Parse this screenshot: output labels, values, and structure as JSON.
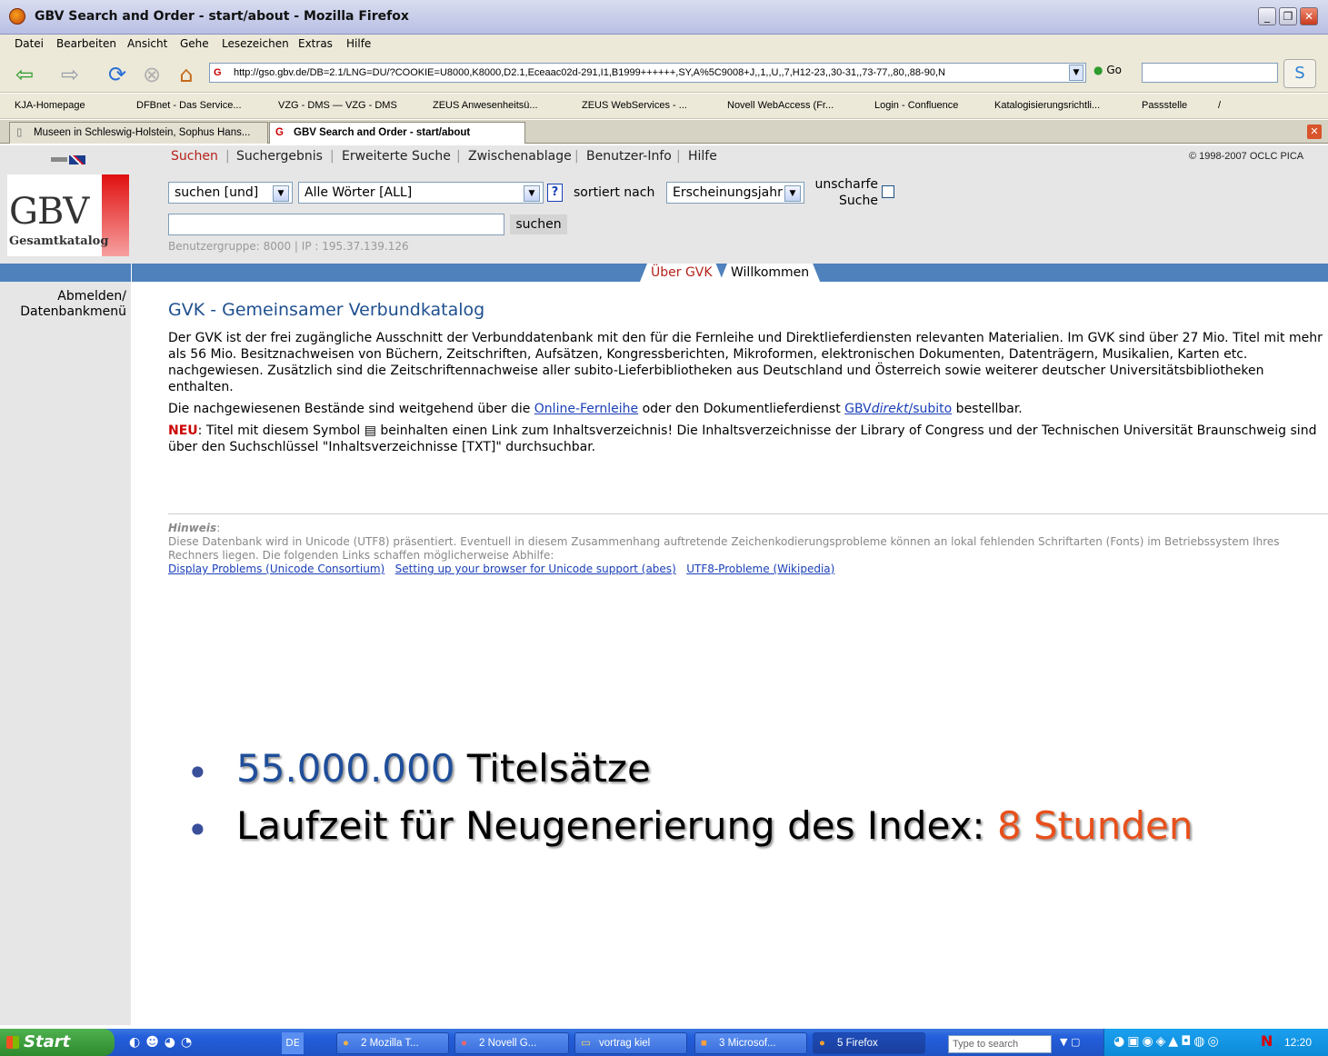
{
  "window": {
    "title": "GBV Search and Order - start/about - Mozilla Firefox"
  },
  "menu": [
    "Datei",
    "Bearbeiten",
    "Ansicht",
    "Gehe",
    "Lesezeichen",
    "Extras",
    "Hilfe"
  ],
  "address": {
    "url": "http://gso.gbv.de/DB=2.1/LNG=DU/?COOKIE=U8000,K8000,D2.1,Eceaac02d-291,I1,B1999++++++,SY,A%5C9008+J,,1,,U,,7,H12-23,,30-31,,73-77,,80,,88-90,N",
    "go_label": "Go"
  },
  "bookmarks": [
    "KJA-Homepage",
    "DFBnet - Das Service...",
    "VZG - DMS — VZG - DMS",
    "ZEUS Anwesenheitsü...",
    "ZEUS WebServices - ...",
    "Novell WebAccess (Fr...",
    "Login - Confluence",
    "Katalogisierungsrichtli...",
    "Passstelle",
    "/"
  ],
  "tabs": [
    {
      "label": "Museen in Schleswig-Holstein, Sophus Hans..."
    },
    {
      "label": "GBV Search and Order - start/about"
    }
  ],
  "page": {
    "logo_main": "GBV",
    "logo_sub": "Gesamtkatalog",
    "nav": [
      "Suchen",
      "Suchergebnis",
      "Erweiterte Suche",
      "Zwischenablage",
      "Benutzer-Info",
      "Hilfe"
    ],
    "copyright": "© 1998-2007 OCLC PICA",
    "search": {
      "mode_value": "suchen [und]",
      "field_value": "Alle Wörter [ALL]",
      "help_label": "?",
      "sort_label": "sortiert nach",
      "sort_value": "Erscheinungsjahr",
      "fuzzy_label_1": "unscharfe",
      "fuzzy_label_2": "Suche",
      "button_label": "suchen",
      "query_value": "",
      "usergroup": "Benutzergruppe: 8000 | IP : 195.37.139.126"
    },
    "sidebar": {
      "logout_1": "Abmelden/",
      "logout_2": "Datenbankmenü"
    },
    "page_tabs": [
      "Über GVK",
      "Willkommen"
    ],
    "heading": "GVK - Gemeinsamer Verbundkatalog",
    "para1": "Der GVK ist der frei zugängliche Ausschnitt der Verbunddatenbank mit den für die Fernleihe und Direktlieferdiensten relevanten Materialien. Im GVK sind über 27 Mio. Titel mit mehr als 56 Mio. Besitznachweisen von Büchern, Zeitschriften, Aufsätzen, Kongressberichten, Mikroformen, elektronischen Dokumenten, Datenträgern, Musikalien, Karten etc. nachgewiesen. Zusätzlich sind die Zeitschriftennachweise aller subito-Lieferbibliotheken aus Deutschland und Österreich sowie weiterer deutscher Universitätsbibliotheken enthalten.",
    "para2_a": "Die nachgewiesenen Bestände sind weitgehend über die ",
    "para2_link1": "Online-Fernleihe",
    "para2_b": " oder den Dokumentlieferdienst ",
    "para2_link2_a": "GBV",
    "para2_link2_b": "direkt",
    "para2_link2_c": "/subito",
    "para2_c": " bestellbar.",
    "para3_neu": "NEU",
    "para3": ": Titel mit diesem Symbol ▤ beinhalten einen Link zum Inhaltsverzeichnis! Die Inhaltsverzeichnisse der Library of Congress und der Technischen Universität Braunschweig sind über den Suchschlüssel \"Inhaltsverzeichnisse [TXT]\" durchsuchbar.",
    "hint_title": "Hinweis",
    "hint_text": "Diese Datenbank wird in Unicode (UTF8) präsentiert. Eventuell in diesem Zusammenhang auftretende Zeichenkodierungsprobleme können an lokal fehlenden Schriftarten (Fonts) im Betriebssystem Ihres Rechners liegen. Die folgenden Links schaffen möglicherweise Abhilfe:",
    "hint_links": [
      "Display Problems (Unicode Consortium)",
      "Setting up your browser for Unicode support (abes)",
      "UTF8-Probleme (Wikipedia)"
    ]
  },
  "overlay": {
    "line1_num": "55.000.000",
    "line1_text": " Titelsätze",
    "line2_text": "Laufzeit für Neugenerierung des Index: ",
    "line2_hl": "8 Stunden",
    "bullet": "•",
    "num_color": "#1f4e9a",
    "hl_color": "#e8501b"
  },
  "taskbar": {
    "start": "Start",
    "lang": "DE",
    "buttons": [
      "2 Mozilla T...",
      "2 Novell G...",
      "vortrag kiel",
      "3 Microsof...",
      "5 Firefox"
    ],
    "search_placeholder": "Type to search",
    "clock": "12:20"
  }
}
